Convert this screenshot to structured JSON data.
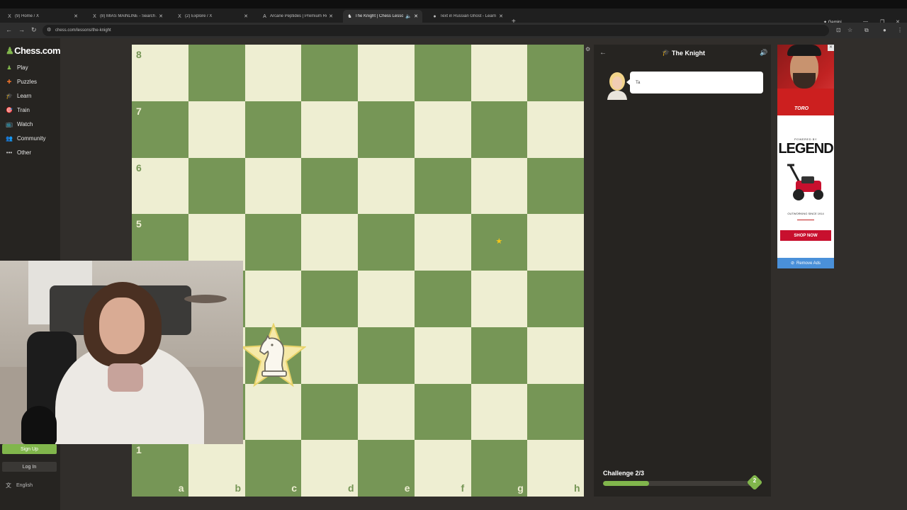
{
  "browser": {
    "tabs": [
      {
        "icon": "X",
        "label": "(9) Home / X"
      },
      {
        "icon": "X",
        "label": "(8) MIAS MAINLINE - Search / X"
      },
      {
        "icon": "X",
        "label": "(2) Explore / X"
      },
      {
        "icon": "A",
        "label": "Arcane Peptides | Premium Re..."
      },
      {
        "icon": "♞",
        "label": "The Knight | Chess Lessons"
      },
      {
        "icon": "●",
        "label": "Text in Russian Ghost - Learn ..."
      }
    ],
    "gemini_label": "Gemini",
    "url": "chess.com/lessons/the-knight"
  },
  "sidebar": {
    "logo": "Chess.com",
    "items": [
      {
        "label": "Play",
        "icon": "play-icon",
        "color": "#81b64c"
      },
      {
        "label": "Puzzles",
        "icon": "puzzle-icon",
        "color": "#e8702a"
      },
      {
        "label": "Learn",
        "icon": "learn-icon",
        "color": "#4fa3e0"
      },
      {
        "label": "Train",
        "icon": "train-icon",
        "color": "#cccccc"
      },
      {
        "label": "Watch",
        "icon": "watch-icon",
        "color": "#cccccc"
      },
      {
        "label": "Community",
        "icon": "community-icon",
        "color": "#4fa3e0"
      },
      {
        "label": "Other",
        "icon": "other-icon",
        "color": "#cccccc"
      }
    ],
    "signup_label": "Sign Up",
    "login_label": "Log In",
    "language": "English"
  },
  "board": {
    "light_color": "#eeeed2",
    "dark_color": "#769656",
    "rank_labels": [
      "8",
      "7",
      "6",
      "5",
      "1"
    ],
    "file_labels": [
      "a",
      "b",
      "c",
      "d",
      "e",
      "f",
      "g",
      "h"
    ],
    "knight_square": "c3",
    "target_star_square": "g5"
  },
  "lesson": {
    "title": "The Knight",
    "coach_message": "Ta",
    "challenge_label": "Challenge 2/3",
    "progress": 0.31,
    "gem_value": "2"
  },
  "ad": {
    "brand": "TORO",
    "powered_by": "POWERED BY",
    "headline": "LEGEND",
    "since": "OUTWORKING SINCE 1914",
    "cta": "SHOP NOW",
    "remove_label": "Remove Ads"
  }
}
